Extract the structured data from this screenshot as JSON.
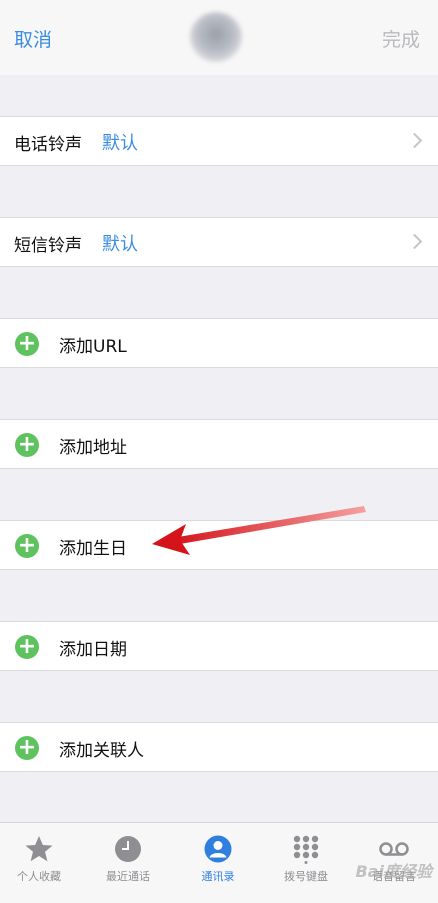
{
  "navbar": {
    "cancel": "取消",
    "done": "完成"
  },
  "settings": {
    "ringtone": {
      "label": "电话铃声",
      "value": "默认"
    },
    "text_tone": {
      "label": "短信铃声",
      "value": "默认"
    }
  },
  "add_rows": [
    {
      "label": "添加URL"
    },
    {
      "label": "添加地址"
    },
    {
      "label": "添加生日"
    },
    {
      "label": "添加日期"
    },
    {
      "label": "添加关联人"
    }
  ],
  "tabbar": {
    "tabs": [
      {
        "label": "个人收藏",
        "icon": "star-icon"
      },
      {
        "label": "最近通话",
        "icon": "clock-icon"
      },
      {
        "label": "通讯录",
        "icon": "contacts-icon",
        "active": true
      },
      {
        "label": "拨号键盘",
        "icon": "keypad-icon"
      },
      {
        "label": "语音留言",
        "icon": "voicemail-icon"
      }
    ]
  },
  "watermark": "Bai度经验",
  "colors": {
    "accent": "#3c8de0",
    "add_green": "#5ec25e",
    "arrow_red": "#e0191b"
  }
}
